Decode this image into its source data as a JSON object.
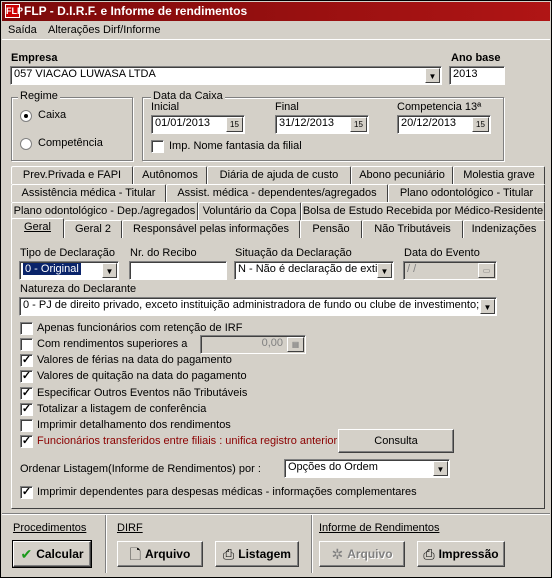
{
  "window": {
    "title": "FLP - D.I.R.F. e Informe de rendimentos",
    "icon_text": "FLP"
  },
  "menu": [
    "Saída",
    "Alterações Dirf/Informe"
  ],
  "empresa": {
    "label": "Empresa",
    "value": "057 VIACAO LUWASA LTDA"
  },
  "ano_base": {
    "label": "Ano base",
    "value": "2013"
  },
  "regime": {
    "label": "Regime",
    "options": [
      "Caixa",
      "Competência"
    ],
    "selected": "Caixa"
  },
  "data_caixa": {
    "label": "Data da Caixa",
    "inicial_label": "Inicial",
    "inicial": "01/01/2013",
    "final_label": "Final",
    "final": "31/12/2013",
    "comp13_label": "Competencia 13ª",
    "comp13": "20/12/2013",
    "fantasia_label": "Imp. Nome fantasia da filial",
    "fantasia_checked": false
  },
  "tabs": {
    "row1": [
      "Prev.Privada e FAPI",
      "Autônomos",
      "Diária de ajuda de custo",
      "Abono pecuniário",
      "Molestia grave"
    ],
    "row2": [
      "Assistência médica - Titular",
      "Assist. médica - dependentes/agregados",
      "Plano odontológico - Titular"
    ],
    "row3": [
      "Plano odontológico - Dep./agregados",
      "Voluntário da Copa",
      "Bolsa de Estudo Recebida por Médico-Residente"
    ],
    "row4": [
      "Geral",
      "Geral 2",
      "Responsável pelas informações",
      "Pensão",
      "Não Tributáveis",
      "Indenizações"
    ],
    "selected": "Geral"
  },
  "geral": {
    "tipo_label": "Tipo de Declaração",
    "tipo_value": "0 - Original",
    "recibo_label": "Nr. do Recibo",
    "recibo_value": "",
    "situacao_label": "Situação da Declaração",
    "situacao_value": "N - Não é declaração de exti",
    "evento_label": "Data do Evento",
    "evento_value": " / /",
    "natureza_label": "Natureza do Declarante",
    "natureza_value": "0 - PJ de direito privado, exceto instituição administradora de fundo ou clube de investimento;",
    "checks": [
      {
        "label": "Apenas funcionários com retenção de IRF",
        "checked": false
      },
      {
        "label": "Com rendimentos superiores a",
        "checked": false
      },
      {
        "label": "Valores de férias na data do pagamento",
        "checked": true
      },
      {
        "label": "Valores de quitação na data do pagamento",
        "checked": true
      },
      {
        "label": "Especificar Outros Eventos não Tributáveis",
        "checked": true
      },
      {
        "label": "Totalizar a listagem de conferência",
        "checked": true
      },
      {
        "label": "Imprimir detalhamento dos rendimentos",
        "checked": false
      },
      {
        "label": "Funcionários transferidos entre filiais : unifica registro anterior",
        "checked": true
      }
    ],
    "rend_value": "0,00",
    "consulta_label": "Consulta",
    "ordenar_label": "Ordenar Listagem(Informe de Rendimentos) por :",
    "ordenar_value": "Opções do Ordem",
    "dependentes_label": "Imprimir dependentes para despesas médicas - informações complementares",
    "dependentes_checked": true
  },
  "footer": {
    "procedimentos": {
      "label": "Procedimentos",
      "calcular": "Calcular"
    },
    "dirf": {
      "label": "DIRF",
      "arquivo": "Arquivo",
      "listagem": "Listagem"
    },
    "informe": {
      "label": "Informe de Rendimentos",
      "arquivo": "Arquivo",
      "impressao": "Impressão"
    }
  },
  "colors": {
    "title_bar": "#a01010",
    "face": "#d4d0c8",
    "selected_field": "#0a246a",
    "warning_text": "#8b0000"
  }
}
